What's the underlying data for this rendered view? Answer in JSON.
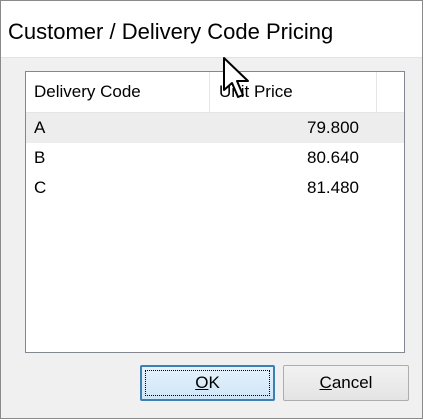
{
  "window": {
    "title": "Customer / Delivery Code Pricing"
  },
  "list": {
    "columns": {
      "code": "Delivery Code",
      "price": "Unit Price"
    },
    "rows": [
      {
        "code": "A",
        "price": "79.800"
      },
      {
        "code": "B",
        "price": "80.640"
      },
      {
        "code": "C",
        "price": "81.480"
      }
    ],
    "selected_row": "A"
  },
  "buttons": {
    "ok": {
      "mnemonic": "O",
      "rest": "K"
    },
    "cancel": {
      "mnemonic": "C",
      "rest": "ancel"
    }
  },
  "colors": {
    "accent_border": "#3c7fb1",
    "selected_row_bg": "#ededed"
  },
  "icons": {
    "cursor": "mouse-pointer-icon"
  }
}
